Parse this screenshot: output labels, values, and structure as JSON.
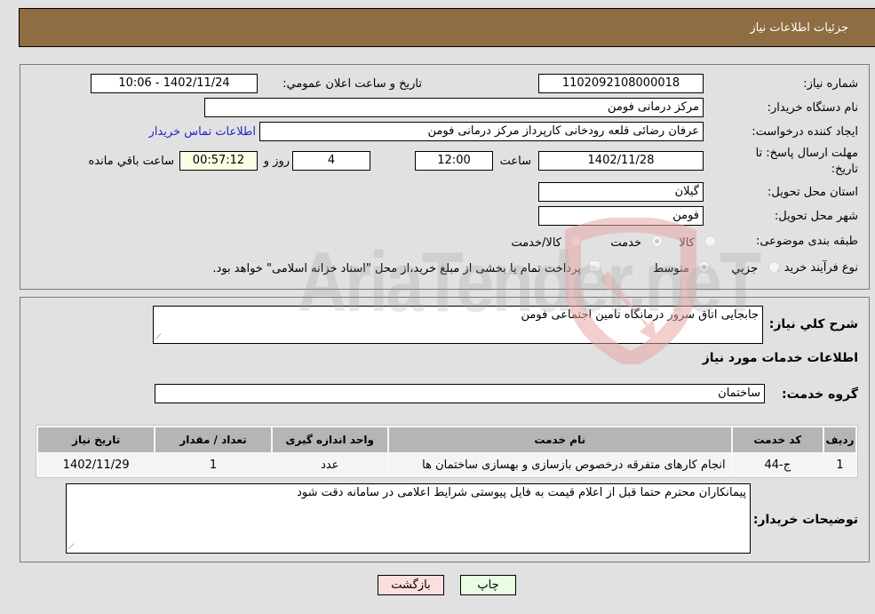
{
  "header": {
    "title": "جزئیات اطلاعات نیاز"
  },
  "need_info": {
    "need_number_label": "شماره نیاز:",
    "need_number": "1102092108000018",
    "announce_label": "تاریخ و ساعت اعلان عمومي:",
    "announce_value": "1402/11/24 - 10:06",
    "buyer_org_label": "نام دستگاه خريدار:",
    "buyer_org": "مرکز درمانی فومن",
    "requester_label": "ايجاد کننده درخواست:",
    "requester": "عرفان رضائی قلعه رودخانی کارپرداز مرکز درمانی فومن",
    "buyer_contact_link": "اطلاعات تماس خريدار",
    "deadline_label_line1": "مهلت ارسال پاسخ: تا",
    "deadline_label_line2": "تاریخ:",
    "deadline_date": "1402/11/28",
    "time_label": "ساعت",
    "deadline_time": "12:00",
    "days_value": "4",
    "days_label": "روز و",
    "remaining_time": "00:57:12",
    "remaining_label": "ساعت باقي مانده",
    "province_label": "استان محل تحويل:",
    "province": "گيلان",
    "city_label": "شهر محل تحويل:",
    "city": "فومن",
    "category_label": "طبقه بندی موضوعی:",
    "category_options": [
      {
        "label": "کالا",
        "checked": false
      },
      {
        "label": "خدمت",
        "checked": true
      },
      {
        "label": "کالا/خدمت",
        "checked": false
      }
    ],
    "process_label": "نوع فرآيند خريد :",
    "process_options": [
      {
        "label": "جزيي",
        "checked": false
      },
      {
        "label": "متوسط",
        "checked": true
      }
    ],
    "treasury_checkbox_label": "پرداخت تمام يا بخشی از مبلغ خريد،از محل \"اسناد خزانه اسلامی\" خواهد بود.",
    "treasury_checked": false
  },
  "details": {
    "description_label": "شرح کلي نياز:",
    "description": "جابجایی اتاق سرور درمانگاه تامین اجتماعی فومن",
    "services_heading": "اطلاعات خدمات مورد نياز",
    "service_group_label": "گروه خدمت:",
    "service_group": "ساختمان",
    "table": {
      "headers": [
        "رديف",
        "کد خدمت",
        "نام خدمت",
        "واحد اندازه گيری",
        "تعداد / مقدار",
        "تاریخ نیاز"
      ],
      "rows": [
        [
          "1",
          "ج-44",
          "انجام کارهای متفرقه درخصوص بازسازی و بهسازی ساختمان ها",
          "عدد",
          "1",
          "1402/11/29"
        ]
      ]
    },
    "buyer_notes_label": "توضيحات خريدار:",
    "buyer_notes": "پیمانکاران محترم حتما قبل از اعلام قیمت به فایل پیوستی شرایط اعلامی در سامانه دقت شود"
  },
  "buttons": {
    "print": "چاپ",
    "back": "بازگشت"
  },
  "watermark": {
    "text": "AriaTender.neT"
  },
  "colors": {
    "header_bg": "#8e6d42",
    "link": "#2222cc",
    "back_btn": "#fddede",
    "print_btn": "#e9fde4"
  }
}
